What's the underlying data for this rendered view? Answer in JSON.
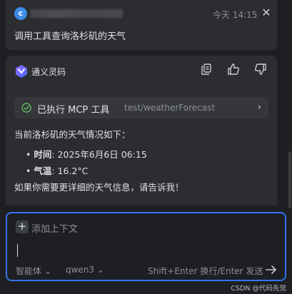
{
  "user_message": {
    "avatar_initial": "c",
    "time": "今天 14:15",
    "close_icon": "close-icon",
    "text": "调用工具查询洛杉矶的天气"
  },
  "assistant": {
    "name": "通义灵码",
    "actions": [
      "copy-icon",
      "thumbs-up-icon",
      "thumbs-down-icon"
    ],
    "tool_call": {
      "label": "已执行 MCP 工具",
      "path": "test/weatherForecast"
    },
    "intro": "当前洛杉矶的天气情况如下：",
    "bullets": [
      {
        "key": "时间",
        "value": ": 2025年6月6日 06:15"
      },
      {
        "key": "气温",
        "value": ": 16.2°C"
      }
    ],
    "outro": "如果你需要更详细的天气信息，请告诉我！"
  },
  "input": {
    "add_context": "添加上下文",
    "mode": "智能体",
    "model": "qwen3",
    "hint": "Shift+Enter 换行/Enter 发送"
  },
  "watermark": "CSDN @代码先觉",
  "colors": {
    "background": "#1e1f22",
    "card": "#2b2d30",
    "accent": "#3574f0",
    "success": "#5fb865"
  }
}
